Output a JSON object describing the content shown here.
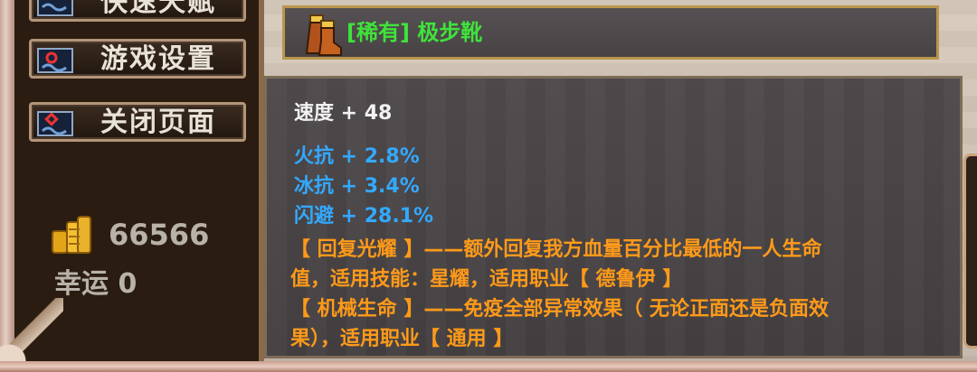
{
  "menu": {
    "talent_label": "快速天赋",
    "settings_label": "游戏设置",
    "close_label": "关闭页面"
  },
  "resources": {
    "gold": "66566",
    "luck": "幸运 0"
  },
  "item": {
    "name": "[稀有] 极步靴",
    "rarity_color": "#3fe33a",
    "stats": [
      {
        "text": "速度 + 48",
        "color": "#f2f2f2"
      },
      {
        "text": "火抗 + 2.8%",
        "color": "#33a9ff"
      },
      {
        "text": "冰抗 + 3.4%",
        "color": "#33a9ff"
      },
      {
        "text": "闪避 + 28.1%",
        "color": "#33a9ff"
      }
    ],
    "skills": [
      {
        "line1": "【 回复光耀 】——额外回复我方血量百分比最低的一人生命",
        "line2": "值，适用技能：星耀，适用职业【 德鲁伊 】"
      },
      {
        "line1": "【 机械生命 】——免疫全部异常效果（ 无论正面还是负面效",
        "line2": "果），适用职业【 通用 】"
      }
    ],
    "skill_color": "#ff9a19"
  }
}
